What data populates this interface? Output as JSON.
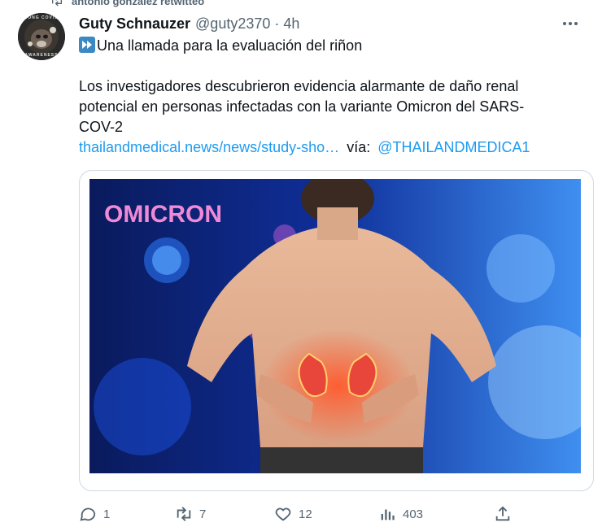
{
  "retweet": {
    "label": "antonio gonzalez retwitteó"
  },
  "tweet": {
    "author_name": "Guty Schnauzer",
    "handle": "@guty2370",
    "separator": "·",
    "time": "4h",
    "headline": "Una llamada para la evaluación del riñon",
    "body_line1": "Los investigadores descubrieron evidencia alarmante de daño renal",
    "body_line2": "potencial en personas infectadas con la variante Omicron del SARS-",
    "body_line3": "COV-2",
    "link_text": "thailandmedical.news/news/study-sho…",
    "via_text": "vía:",
    "via_mention": "@THAILANDMEDICA1",
    "image_overlay_text": "OMICRON"
  },
  "avatar": {
    "text_top": "LONG COVID",
    "text_bottom": "AWARENESS"
  },
  "actions": {
    "reply_count": "1",
    "retweet_count": "7",
    "like_count": "12",
    "view_count": "403"
  },
  "icons": {
    "retweet_header": "retweet-icon",
    "more": "more-icon",
    "fast_forward": "fast-forward-emoji-icon",
    "reply": "reply-icon",
    "retweet": "retweet-icon",
    "like": "heart-icon",
    "views": "views-icon",
    "share": "share-icon"
  },
  "colors": {
    "link": "#1d9bf0",
    "muted": "#536471",
    "text": "#0f1419",
    "emoji_blue": "#3b88c3"
  }
}
